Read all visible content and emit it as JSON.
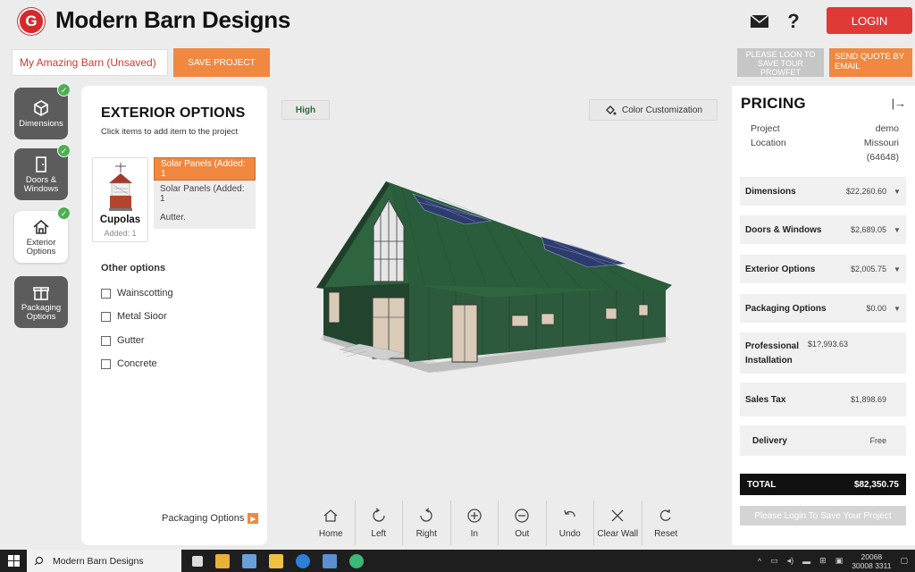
{
  "header": {
    "logo_letter": "G",
    "title": "Modern Barn Designs",
    "mail_icon": "mail-icon",
    "help_icon": "help-icon",
    "login_label": "LOGIN"
  },
  "project": {
    "name": "My Amazing Barn (Unsaved)",
    "save_label": "SAVE PROJECT",
    "login_to_save_label": "PLEASE LOON TO SAVE TOUR PROWFET",
    "send_quote_label": "SEND QUOTE BY EMAIL"
  },
  "rail": {
    "items": [
      {
        "label": "Dimensions",
        "icon": "box-icon",
        "done": true
      },
      {
        "label": "Doors & Windows",
        "icon": "door-icon",
        "done": true
      },
      {
        "label": "Exterior Options",
        "icon": "house-icon",
        "done": true
      },
      {
        "label": "Packaging Options",
        "icon": "gift-icon",
        "done": false
      }
    ]
  },
  "exterior": {
    "title": "EXTERIOR OPTIONS",
    "subtitle": "Click items to add item to the project",
    "cupola": {
      "name": "Cupolas",
      "added": "Added: 1"
    },
    "dropdown": [
      "Solar Panels (Added: 1",
      "Solar Panels (Added: 1",
      "Autter."
    ],
    "other_title": "Other options",
    "other_options": [
      "Wainscotting",
      "Metal Sioor",
      "Gutter",
      "Concrete"
    ],
    "packaging_link": "Packaging Options"
  },
  "viewer": {
    "quality_label": "High",
    "color_label": "Color Customization",
    "toolbar": [
      "Home",
      "Left",
      "Right",
      "In",
      "Out",
      "Undo",
      "Clear Wall",
      "Reset"
    ]
  },
  "pricing": {
    "title": "PRICING",
    "project_label": "Project",
    "project_value": "demo",
    "location_label": "Location",
    "location_value": "Missouri",
    "location_zip": "(64648)",
    "rows": [
      {
        "label": "Dimensions",
        "value": "$22,260.60",
        "caret": "▼"
      },
      {
        "label": "Doors & Windows",
        "value": "$2,689.05",
        "caret": "▼"
      },
      {
        "label": "Exterior Options",
        "value": "$2,005.75",
        "caret": "▼"
      },
      {
        "label": "Packaging Options",
        "value": "$0.00",
        "caret": "▼"
      },
      {
        "label": "Professional Installation",
        "value": "$1?,993.63",
        "caret": ""
      },
      {
        "label": "Sales Tax",
        "value": "$1,898.69",
        "caret": ""
      },
      {
        "label": "Delivery",
        "value": "Free",
        "caret": ""
      }
    ],
    "total_label": "TOTAL",
    "total_value": "$82,350.75",
    "login_save_label": "Please Login To Save Your Project"
  },
  "taskbar": {
    "search_text": "Modern Barn Designs",
    "clock_time": "20068",
    "clock_date": "30008 3311"
  },
  "colors": {
    "accent_orange": "#f08840",
    "login_red": "#e03a36",
    "barn_green": "#2a5a3a"
  }
}
